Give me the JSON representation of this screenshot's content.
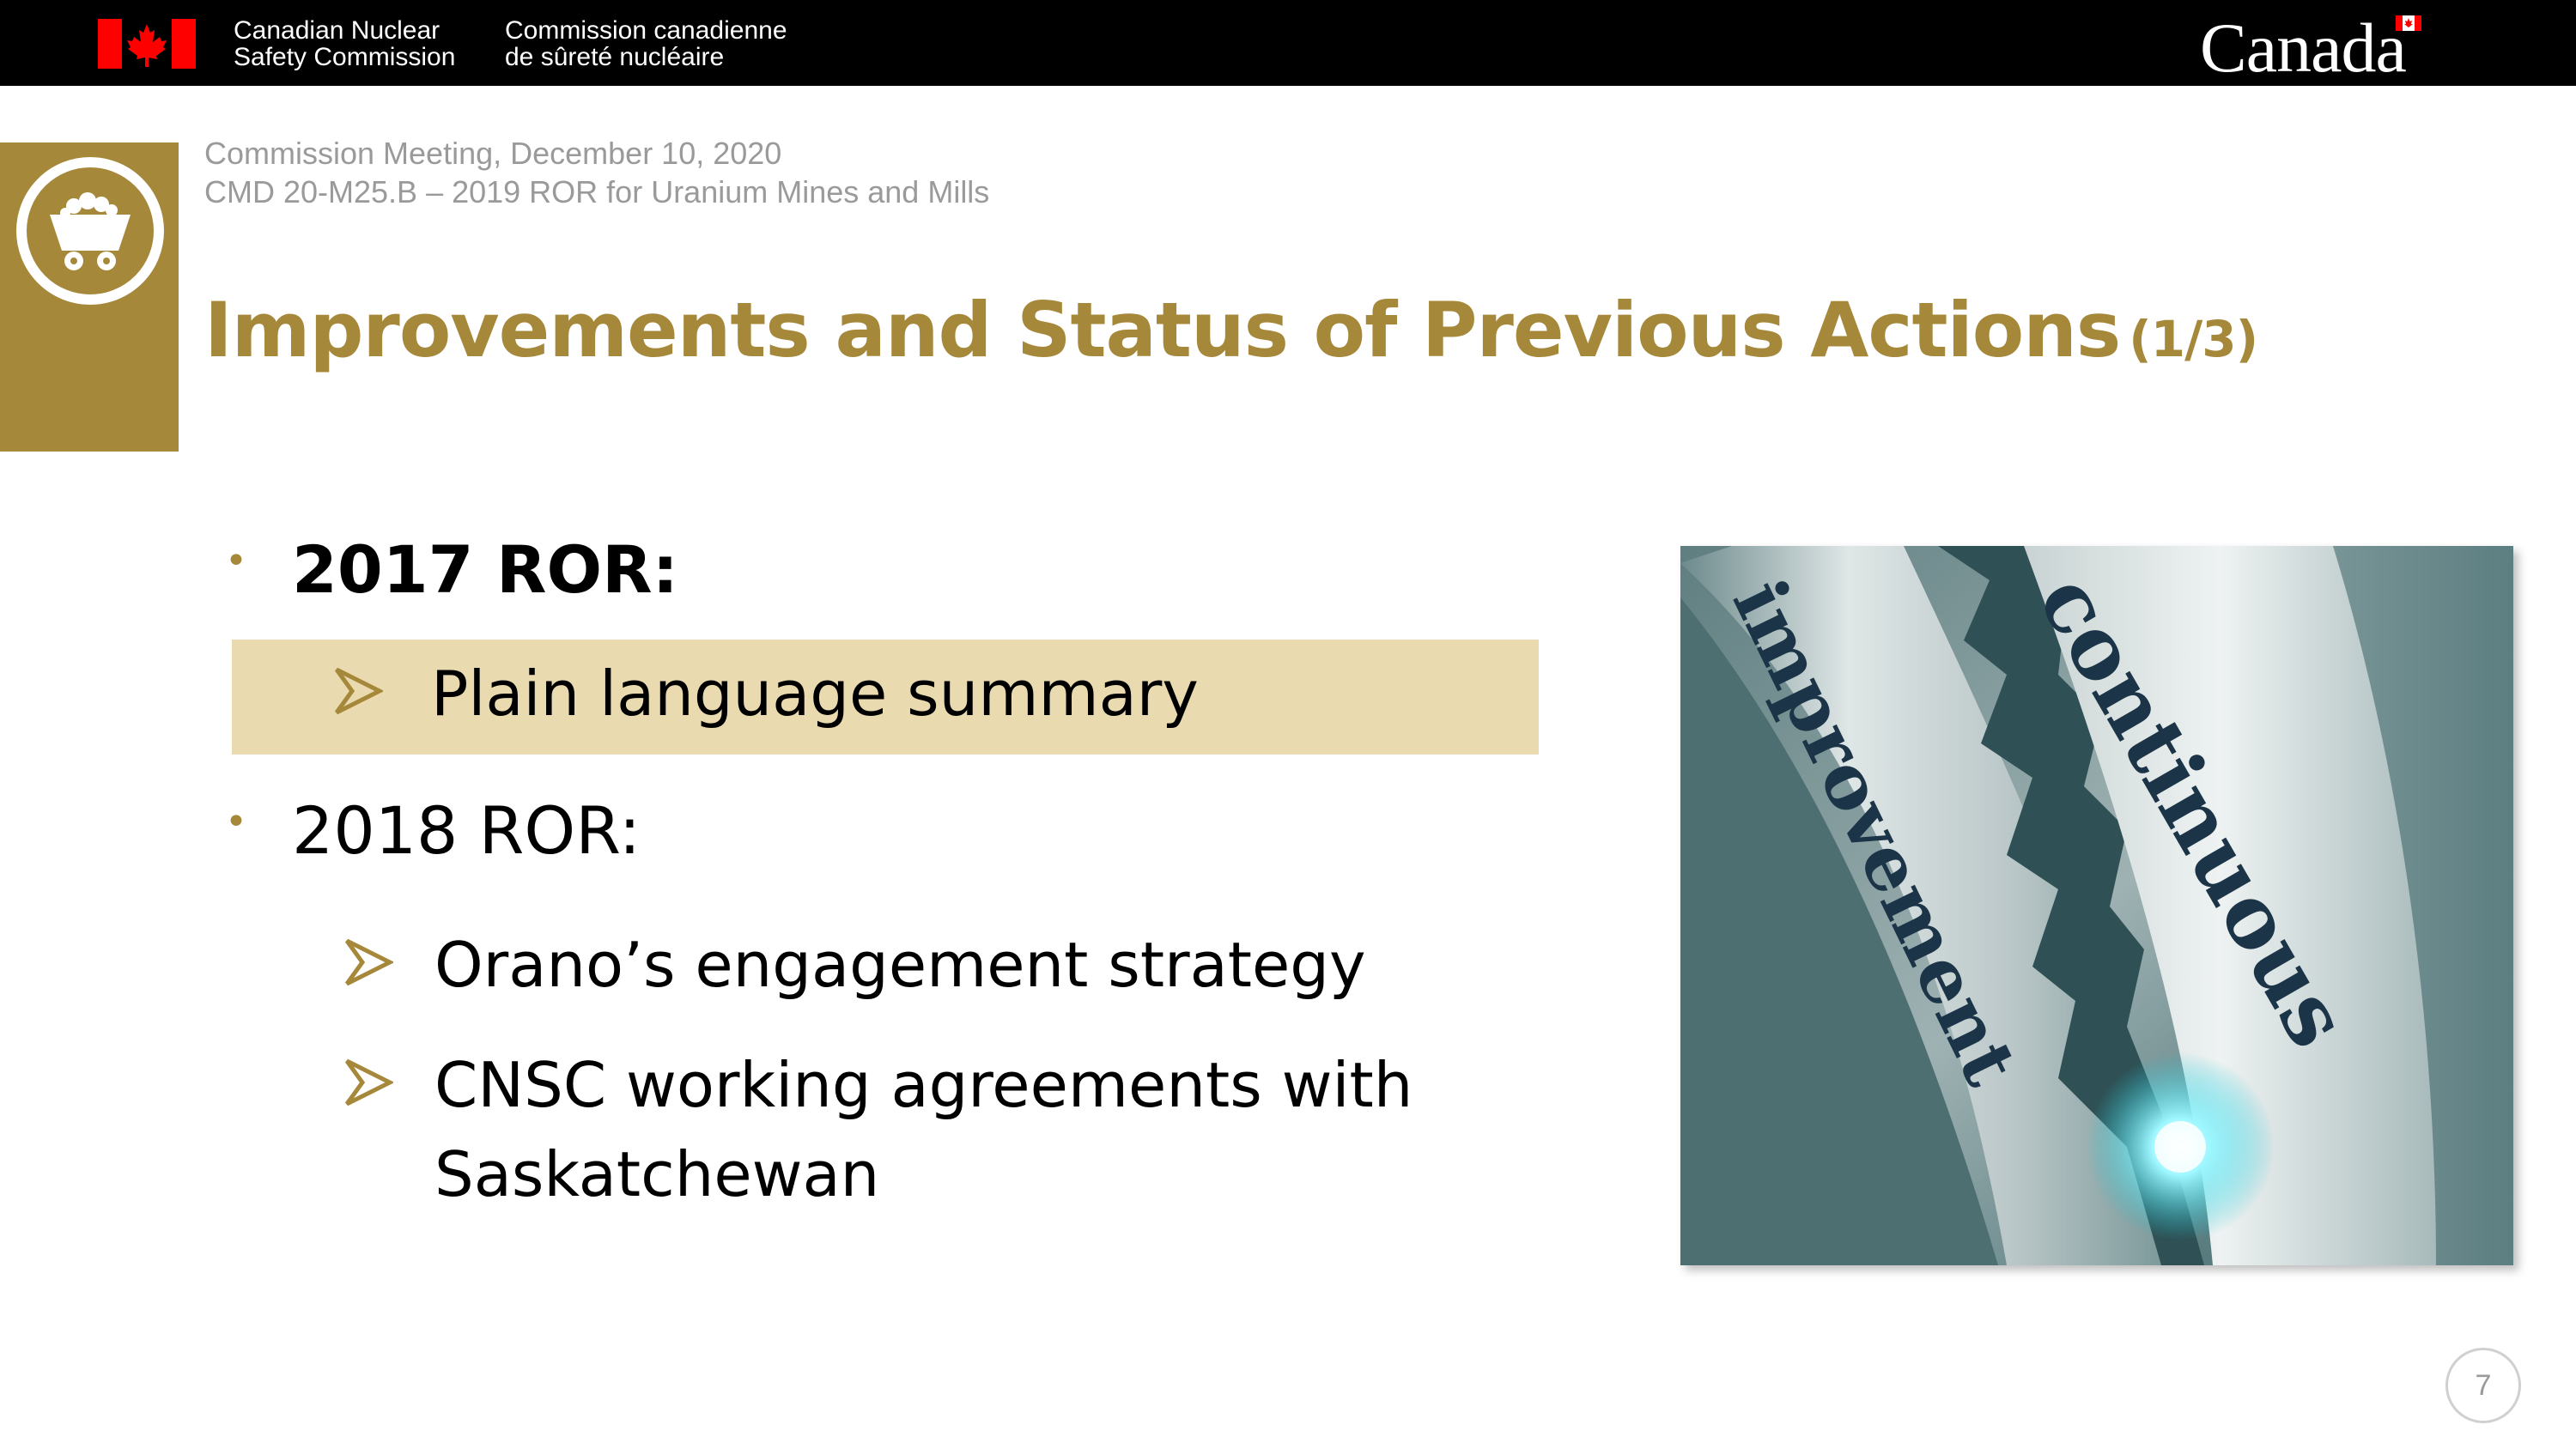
{
  "header": {
    "org_en": [
      "Canadian Nuclear",
      "Safety Commission"
    ],
    "org_fr": [
      "Commission canadienne",
      "de sûreté nucléaire"
    ],
    "wordmark": "Canada",
    "flag_red": "#ff0000"
  },
  "sidebar": {
    "icon": "mine-cart-icon",
    "color": "#a6883a"
  },
  "slide": {
    "meta_line_1": "Commission Meeting, December 10, 2020",
    "meta_line_2": "CMD 20-M25.B – 2019 ROR for Uranium Mines and Mills",
    "title": "Improvements and Status of Previous Actions",
    "title_suffix": "(1/3)",
    "title_color": "#a6883a",
    "bullets": [
      {
        "label": "2017 ROR:",
        "bold": true,
        "items": [
          "Plain language summary"
        ],
        "highlight_color": "#e9dab0"
      },
      {
        "label": "2018 ROR:",
        "bold": false,
        "items": [
          "Orano’s engagement strategy",
          [
            "CNSC working agreements with",
            "Saskatchewan"
          ]
        ]
      }
    ],
    "image_words": [
      "continuous",
      "improvement"
    ],
    "page_number": "7"
  }
}
